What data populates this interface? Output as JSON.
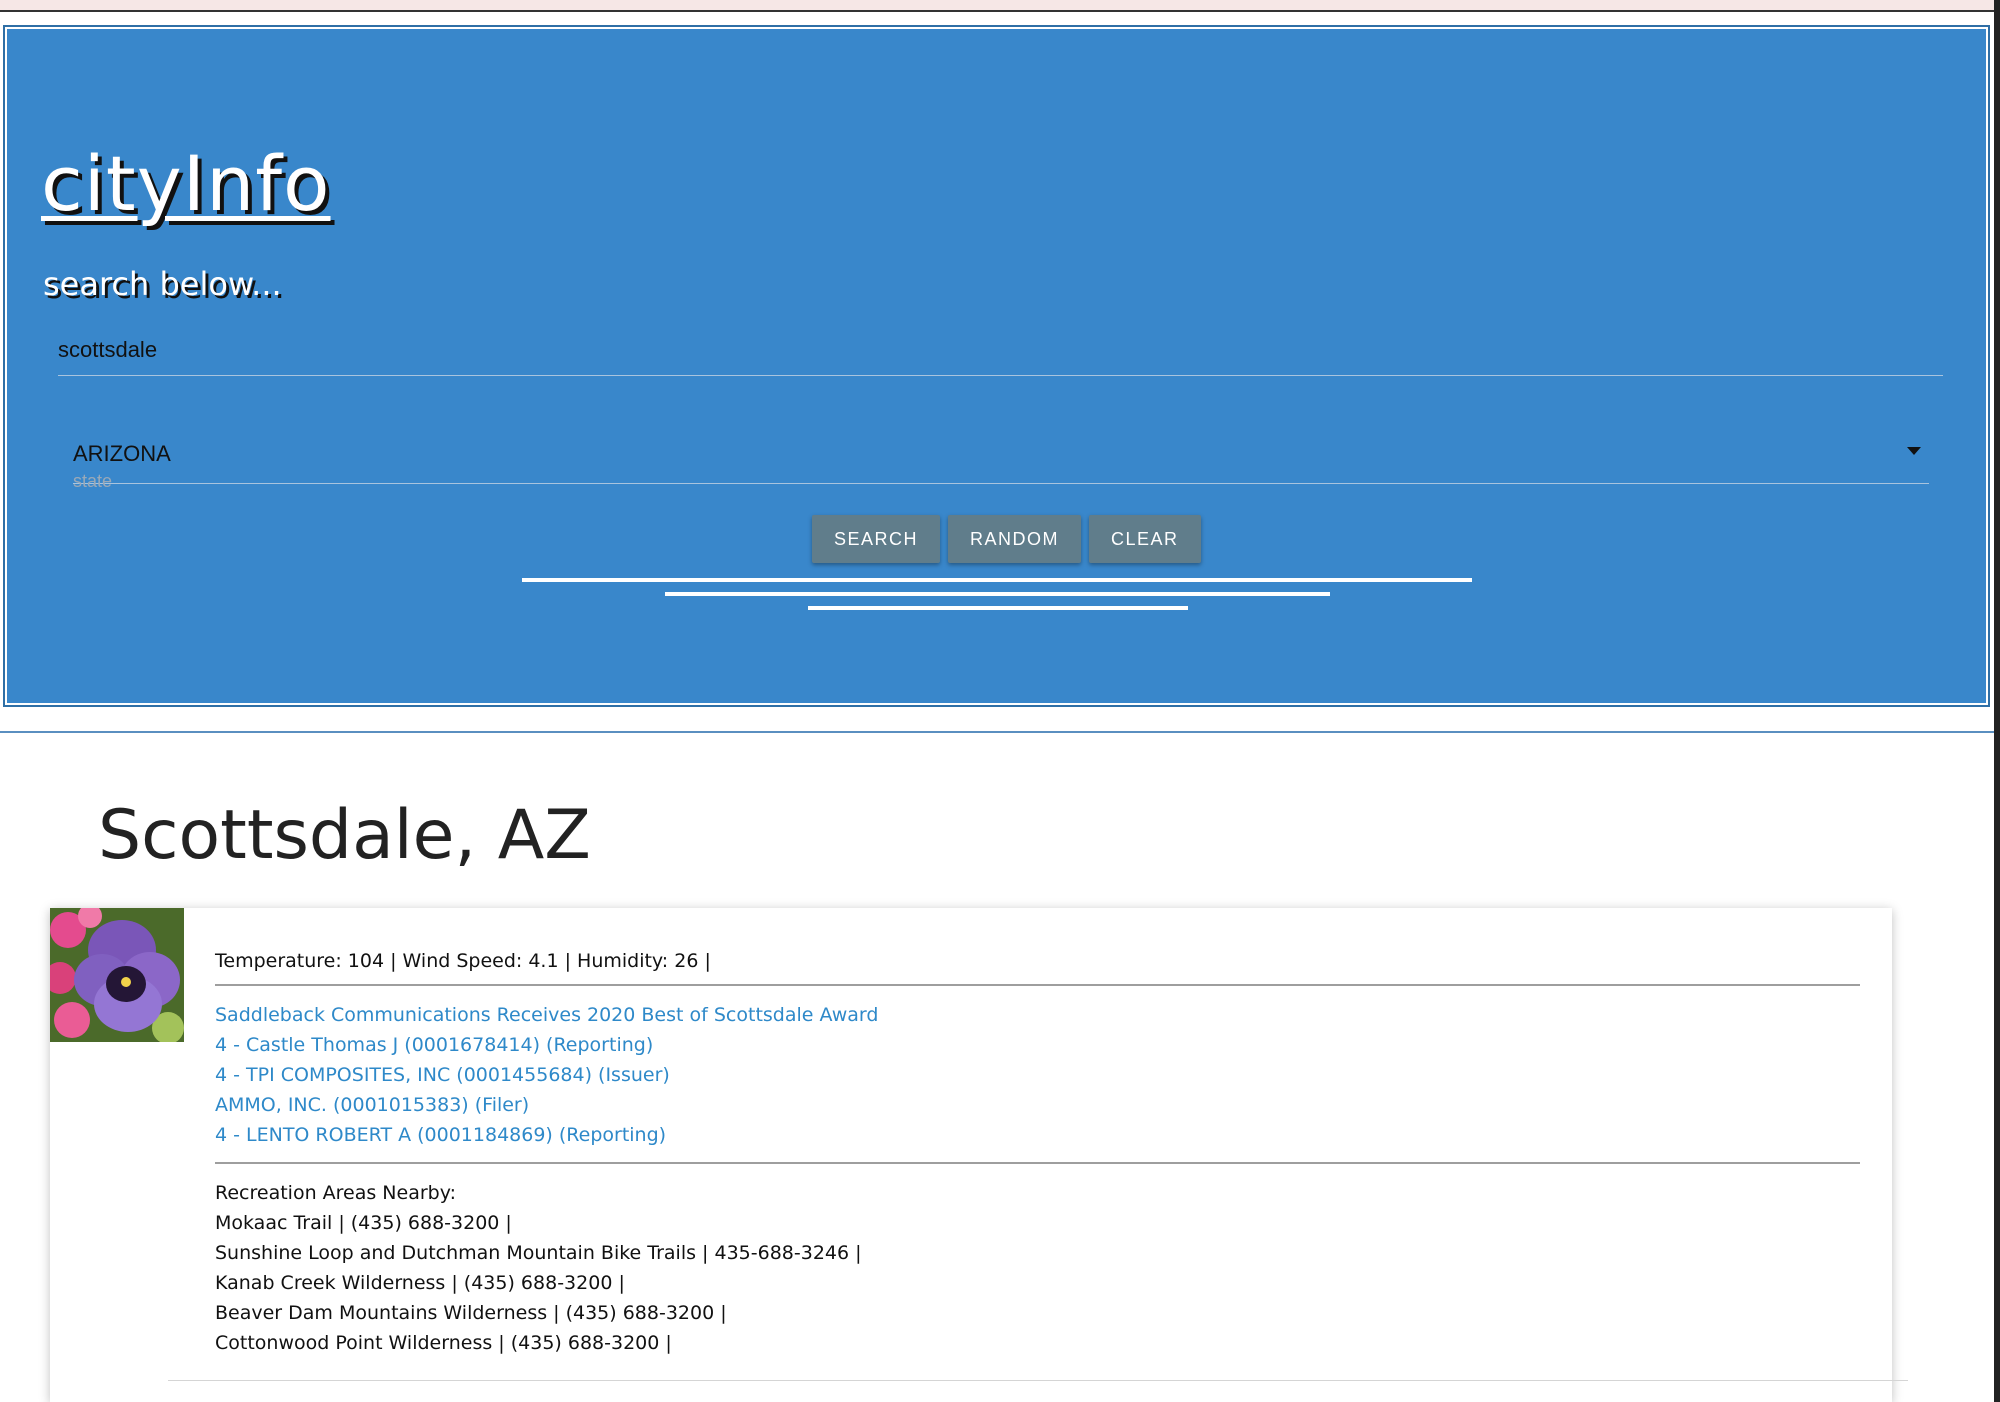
{
  "header": {
    "logo": "cityInfo",
    "subtitle": "search below...",
    "background_color": "#3987cb"
  },
  "search": {
    "city_value": "scottsdale",
    "state_value": "ARIZONA",
    "state_label": "state",
    "buttons": {
      "search": "SEARCH",
      "random": "RANDOM",
      "clear": "CLEAR"
    }
  },
  "result": {
    "title": "Scottsdale, AZ",
    "weather": "Temperature: 104 | Wind Speed: 4.1 | Humidity: 26 |",
    "news": [
      "Saddleback Communications Receives 2020 Best of Scottsdale Award",
      "4 - Castle Thomas J (0001678414) (Reporting)",
      "4 - TPI COMPOSITES, INC (0001455684) (Issuer)",
      "AMMO, INC. (0001015383) (Filer)",
      "4 - LENTO ROBERT A (0001184869) (Reporting)"
    ],
    "recreation_heading": "Recreation Areas Nearby:",
    "recreation": [
      "Mokaac Trail | (435) 688-3200 |",
      "Sunshine Loop and Dutchman Mountain Bike Trails | 435-688-3246 |",
      "Kanab Creek Wilderness | (435) 688-3200 |",
      "Beaver Dam Mountains Wilderness | (435) 688-3200 |",
      "Cottonwood Point Wilderness | (435) 688-3200 |"
    ],
    "link_color": "#2e89c9"
  }
}
